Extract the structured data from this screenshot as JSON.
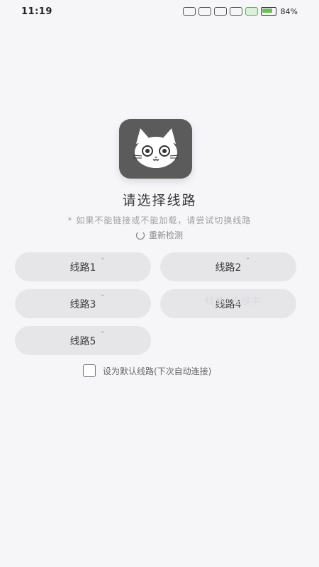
{
  "status": {
    "time": "11:19",
    "battery": "84%"
  },
  "app": {
    "title": "请选择线路",
    "subtitle": "* 如果不能链接或不能加载，请尝试切换线路",
    "recheck_label": "重新检测"
  },
  "lines": [
    {
      "label": "线路1"
    },
    {
      "label": "线路2"
    },
    {
      "label": "线路3"
    },
    {
      "label": "线路4"
    },
    {
      "label": "线路5"
    }
  ],
  "overlay": {
    "connecting_text": "线路1连接中"
  },
  "settings": {
    "default_line_label": "设为默认线路(下次自动连接)"
  },
  "colors": {
    "logo_bg": "#5b5b5b",
    "button_bg": "#e6e6e9",
    "page_bg": "#f6f6f9"
  }
}
